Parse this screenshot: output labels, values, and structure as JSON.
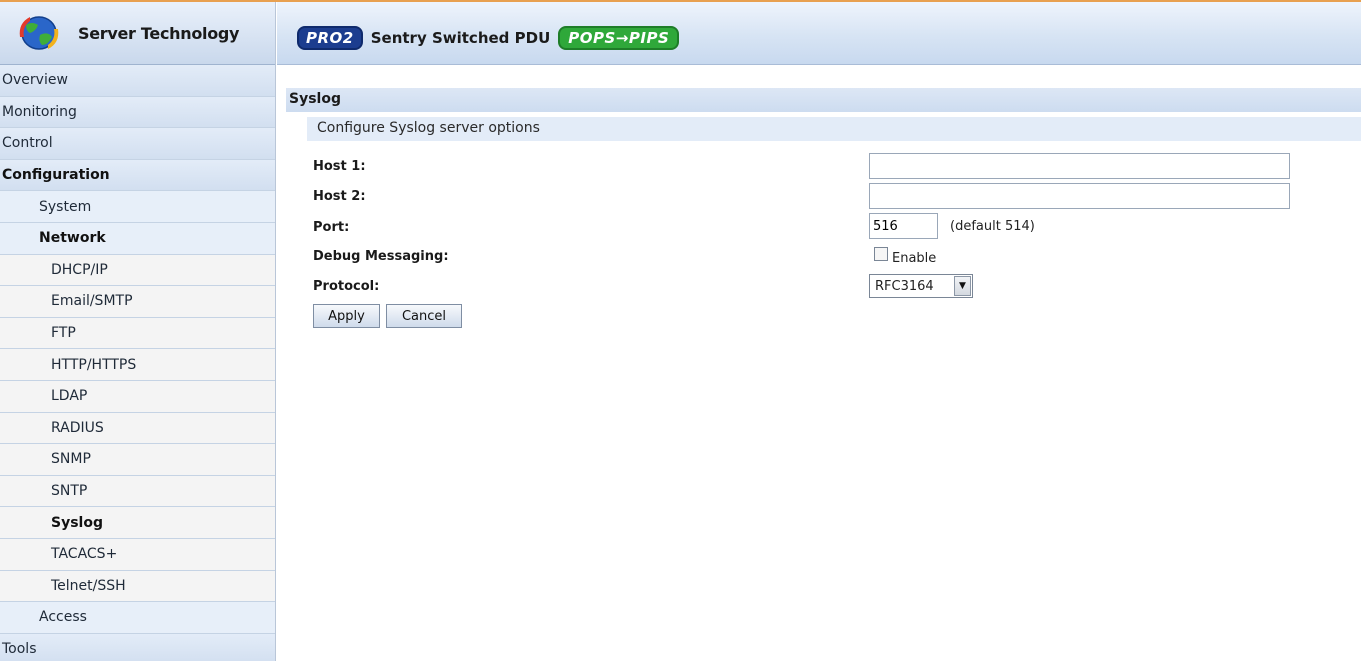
{
  "brand": {
    "name": "Server Technology"
  },
  "header": {
    "badge_left": "PRO2",
    "title": "Sentry Switched PDU",
    "badge_right": "POPS→PIPS"
  },
  "nav": {
    "overview": "Overview",
    "monitoring": "Monitoring",
    "control": "Control",
    "configuration": "Configuration",
    "system": "System",
    "network": "Network",
    "dhcp": "DHCP/IP",
    "email": "Email/SMTP",
    "ftp": "FTP",
    "http": "HTTP/HTTPS",
    "ldap": "LDAP",
    "radius": "RADIUS",
    "snmp": "SNMP",
    "sntp": "SNTP",
    "syslog": "Syslog",
    "tacacs": "TACACS+",
    "telnet": "Telnet/SSH",
    "access": "Access",
    "tools": "Tools"
  },
  "section": {
    "title": "Syslog",
    "subtitle": "Configure Syslog server options"
  },
  "form": {
    "host1_label": "Host 1:",
    "host1_value": "",
    "host2_label": "Host 2:",
    "host2_value": "",
    "port_label": "Port:",
    "port_value": "516",
    "port_hint": "(default 514)",
    "debug_label": "Debug Messaging:",
    "debug_enable_label": "Enable",
    "protocol_label": "Protocol:",
    "protocol_value": "RFC3164",
    "apply_label": "Apply",
    "cancel_label": "Cancel"
  }
}
